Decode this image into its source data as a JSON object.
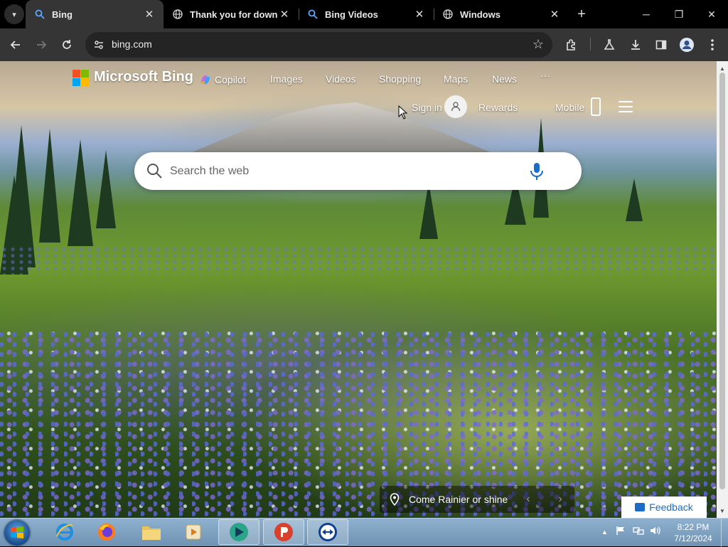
{
  "browser": {
    "tabs": [
      {
        "title": "Bing",
        "icon": "search-icon",
        "active": true
      },
      {
        "title": "Thank you for downlo",
        "icon": "globe-icon",
        "active": false
      },
      {
        "title": "Bing Videos",
        "icon": "search-icon",
        "active": false
      },
      {
        "title": "Windows",
        "icon": "globe-icon",
        "active": false
      }
    ],
    "new_tab_icon": "plus-icon",
    "window_controls": {
      "minimize": "─",
      "restore": "❐",
      "close": "✕"
    },
    "address": {
      "url": "bing.com",
      "site_icon": "site-info-icon"
    },
    "toolbar_icons": [
      "back-icon",
      "forward-icon",
      "reload-icon",
      "star-icon",
      "extensions-icon",
      "labs-icon",
      "download-icon",
      "side-panel-icon",
      "profile-icon",
      "menu-icon"
    ]
  },
  "bing": {
    "brand": "Microsoft Bing",
    "nav": [
      "Copilot",
      "Images",
      "Videos",
      "Shopping",
      "Maps",
      "News",
      "···"
    ],
    "sign_in": "Sign in",
    "rewards": "Rewards",
    "mobile": "Mobile",
    "search": {
      "placeholder": "Search the web",
      "value": ""
    },
    "caption": "Come Rainier or shine",
    "feedback": "Feedback",
    "colors": {
      "ms_red": "#f25022",
      "ms_green": "#7fba00",
      "ms_blue": "#00a4ef",
      "ms_yellow": "#ffb900",
      "link_blue": "#1a6cc7"
    }
  },
  "taskbar": {
    "apps": [
      "internet-explorer-icon",
      "firefox-icon",
      "file-explorer-icon",
      "media-player-icon",
      "bing-app-icon",
      "proxy-app-icon",
      "teamviewer-icon"
    ],
    "tray": {
      "show_hidden": "▲"
    },
    "clock": {
      "time": "8:22 PM",
      "date": "7/12/2024"
    }
  }
}
